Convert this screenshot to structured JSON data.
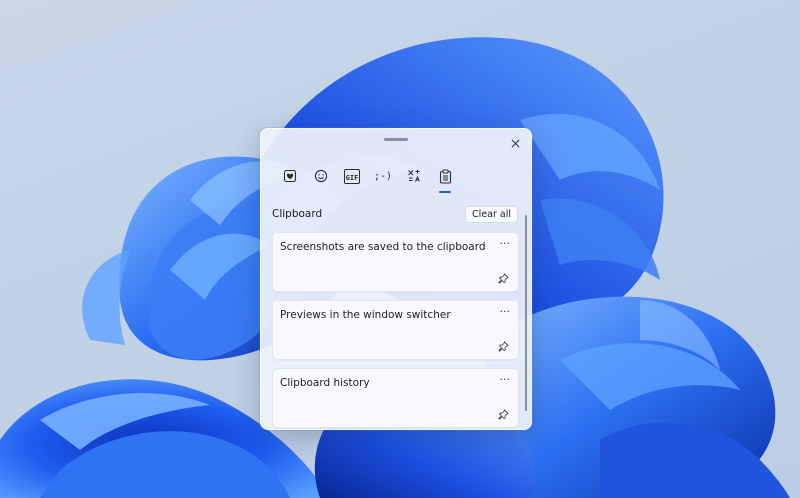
{
  "panel": {
    "close_icon": "close-icon",
    "drag_handle": "drag-handle"
  },
  "tabs": [
    {
      "name": "recently-used-tab",
      "icon": "heart-sticker-icon",
      "label": ""
    },
    {
      "name": "emoji-tab",
      "icon": "smiley-icon",
      "label": ""
    },
    {
      "name": "gif-tab",
      "icon": "gif-icon",
      "label": "GIF"
    },
    {
      "name": "kaomoji-tab",
      "icon": "kaomoji-icon",
      "label": ";-)"
    },
    {
      "name": "symbols-tab",
      "icon": "symbols-icon",
      "label": ""
    },
    {
      "name": "clipboard-tab",
      "icon": "clipboard-icon",
      "label": "",
      "active": true
    }
  ],
  "clipboard": {
    "title": "Clipboard",
    "clear_all_label": "Clear all",
    "items": [
      {
        "text": "Screenshots are saved to the clipboard",
        "more_label": "···",
        "pin_icon": "pin-icon"
      },
      {
        "text": "Previews in the window switcher",
        "more_label": "···",
        "pin_icon": "pin-icon"
      },
      {
        "text": "Clipboard history",
        "more_label": "···",
        "pin_icon": "pin-icon"
      }
    ]
  },
  "colors": {
    "accent": "#1a5fc0",
    "wallpaper_bloom": "#1f5fe6",
    "desktop_bg": "#c4d3e6"
  }
}
